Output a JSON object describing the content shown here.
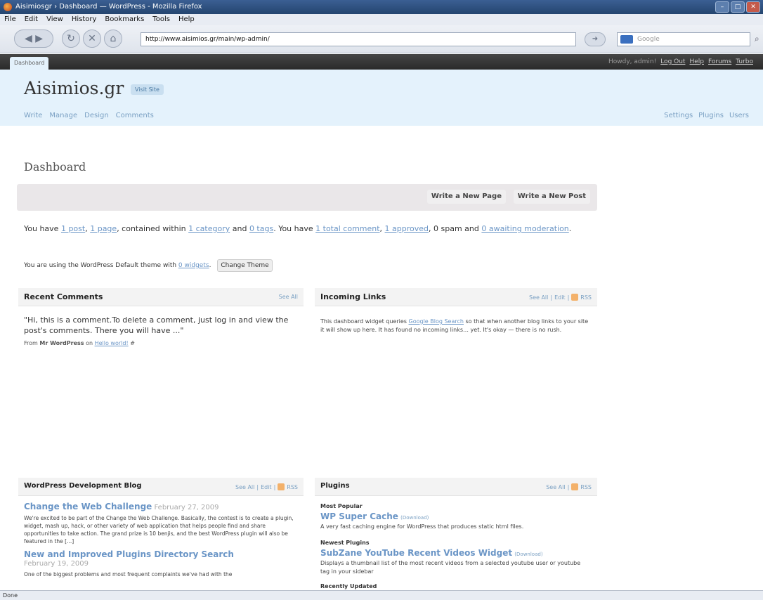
{
  "browser": {
    "title": "Aisimiosgr › Dashboard — WordPress - Mozilla Firefox",
    "menu": [
      "File",
      "Edit",
      "View",
      "History",
      "Bookmarks",
      "Tools",
      "Help"
    ],
    "url": "http://www.aisimios.gr/main/wp-admin/",
    "search_placeholder": "Google",
    "status": "Done"
  },
  "wp": {
    "tab": "Dashboard",
    "user_links": [
      "Howdy, admin!",
      "Log Out",
      "Help",
      "Forums",
      "Turbo"
    ],
    "site_name": "Aisimios.gr",
    "visit_site": "Visit Site",
    "nav": [
      "Write",
      "Manage",
      "Design",
      "Comments"
    ],
    "right_nav": [
      "Settings",
      "Plugins",
      "Users"
    ],
    "page_title": "Dashboard",
    "write_page": "Write a New Page",
    "write_post": "Write a New Post",
    "rightnow": {
      "t1": "You have ",
      "posts": "1 post",
      "sep1": ", ",
      "pages": "1 page",
      "t2": ", contained within ",
      "cats": "1 category",
      "t3": " and ",
      "tags": "0 tags",
      "t4": ". You have ",
      "comments": "1 total comment",
      "sep2": ", ",
      "approved": "1 approved",
      "t5": ", 0 spam and ",
      "moderation": "0 awaiting moderation",
      "t6": "."
    },
    "theme": {
      "t1": "You are using the WordPress Default theme with ",
      "widgets": "0 widgets",
      "t2": ".",
      "button": "Change Theme"
    },
    "recent_comments": {
      "title": "Recent Comments",
      "see_all": "See All",
      "text": "\"Hi, this is a comment.To delete a comment, just log in and view the post's comments. There you will have ...\"",
      "from_label": "From ",
      "author": "Mr WordPress",
      "on": " on ",
      "post": "Hello world!",
      "hash": " #"
    },
    "incoming_links": {
      "title": "Incoming Links",
      "links": [
        "See All",
        "|",
        "Edit",
        "|"
      ],
      "rss": "RSS",
      "t1": "This dashboard widget queries ",
      "gbs": "Google Blog Search",
      "t2": " so that when another blog links to your site it will show up here. It has found no incoming links… yet. It's okay — there is no rush."
    },
    "dev_blog": {
      "title": "WordPress Development Blog",
      "links": [
        "See All",
        "|",
        "Edit",
        "|"
      ],
      "rss": "RSS",
      "posts": [
        {
          "title": "Change the Web Challenge",
          "date": " February 27, 2009",
          "excerpt": "We're excited to be part of the Change the Web Challenge. Basically, the contest is to create a plugin, widget, mash up, hack, or other variety of web application that helps people find and share opportunities to take action. The grand prize is 10 benjis, and the best WordPress plugin will also be featured in the [...]"
        },
        {
          "title": "New and Improved Plugins Directory Search",
          "date": "February 19, 2009",
          "excerpt": "One of the biggest problems and most frequent complaints we've had with the"
        }
      ]
    },
    "plugins": {
      "title": "Plugins",
      "links": [
        "See All",
        "|"
      ],
      "rss": "RSS",
      "sections": [
        {
          "heading": "Most Popular",
          "name": "WP Super Cache",
          "dl": "(Download)",
          "desc": "A very fast caching engine for WordPress that produces static html files."
        },
        {
          "heading": "Newest Plugins",
          "name": "SubZane YouTube Recent Videos Widget",
          "dl": "(Download)",
          "desc": "Displays a thumbnail list of the most recent videos from a selected youtube user or youtube tag in your sidebar"
        }
      ],
      "recently_updated": "Recently Updated"
    }
  }
}
